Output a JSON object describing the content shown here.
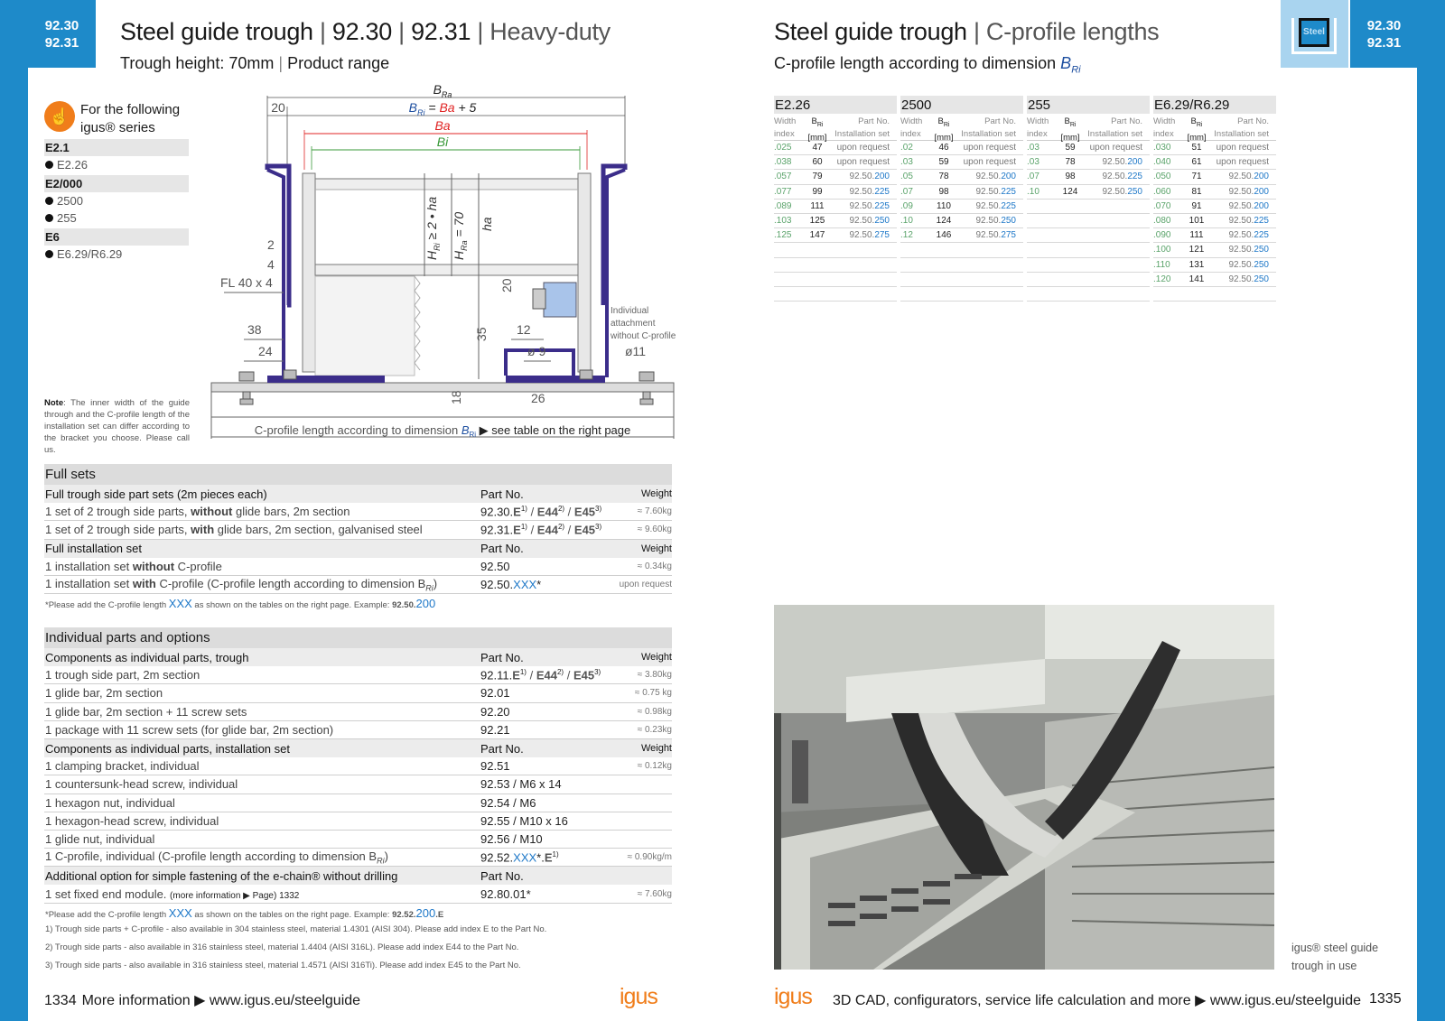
{
  "left_page": {
    "page_numbers": [
      "92.30",
      "92.31"
    ],
    "title_main": "Steel guide trough",
    "title_sep_1": " | ",
    "title_code_1": "92.30",
    "title_sep_2": " | ",
    "title_code_2": "92.31",
    "title_sep_3": " | ",
    "title_light": "Heavy-duty",
    "subtitle_a": "Trough height: 70mm",
    "subtitle_sep": " | ",
    "subtitle_b": "Product range",
    "series_intro": "For the following igus® series",
    "series_groups": [
      {
        "name": "E2.1",
        "items": [
          "E2.26"
        ]
      },
      {
        "name": "E2/000",
        "items": [
          "2500",
          "255"
        ]
      },
      {
        "name": "E6",
        "items": [
          "E6.29/R6.29"
        ]
      }
    ],
    "note_label": "Note",
    "note_text": ": The inner width of the guide through and the C-profile length of the installation set can differ according to the bracket you choose. Please call us.",
    "drawing": {
      "bra": "B",
      "bra_sub": "Ra",
      "formula_b": "B",
      "formula_sub": "Ri",
      "formula_eq": " = ",
      "formula_ba": "Ba",
      "formula_plus": " + 5",
      "ba": "Ba",
      "bi": "Bi",
      "dim_20": "20",
      "dim_2": "2",
      "dim_4": "4",
      "fl": "FL 40 x 4",
      "dim_38": "38",
      "dim_24": "24",
      "hri": "H",
      "hri_sub": "Ri",
      "hri_rest": " ≥ 2 • ha",
      "hra": "H",
      "hra_sub": "Ra",
      "hra_rest": " = 70",
      "ha": "ha",
      "dim_20v": "20",
      "dim_35": "35",
      "dim_12": "12",
      "dim_d9": "ø 9",
      "dim_18": "18",
      "dim_26": "26",
      "dim_d11": "ø11",
      "attachment": [
        "Individual",
        "attachment",
        "without C-profile"
      ],
      "bottom_label_a": "C-profile length according to dimension ",
      "bottom_label_b": "B",
      "bottom_label_sub": "Ri",
      "bottom_label_c": " ▶ see table on the right page"
    },
    "full_sets": {
      "title": "Full sets",
      "rows": [
        {
          "type": "hd",
          "c1": "Full trough side part sets (2m pieces each)",
          "c2": "Part No.",
          "c3": "Weight"
        },
        {
          "type": "row",
          "c1a": "1 set of 2 trough side parts, ",
          "c1b": "without",
          "c1c": " glide bars, 2m section",
          "c2a": "92.30.",
          "c2b": "E",
          "c2c": "1)",
          "c2d": " / ",
          "c2e": "E44",
          "c2f": "2)",
          "c2g": " / ",
          "c2h": "E45",
          "c2i": "3)",
          "c3": "≈ 7.60kg"
        },
        {
          "type": "row",
          "c1a": "1 set of 2 trough side parts, ",
          "c1b": "with",
          "c1c": " glide bars, 2m section, galvanised steel",
          "c2a": "92.31.",
          "c2b": "E",
          "c2c": "1)",
          "c2d": " / ",
          "c2e": "E44",
          "c2f": "2)",
          "c2g": " / ",
          "c2h": "E45",
          "c2i": "3)",
          "c3": "≈ 9.60kg"
        },
        {
          "type": "hd",
          "c1": "Full installation set",
          "c2": "Part No.",
          "c3": "Weight"
        },
        {
          "type": "row",
          "c1a": "1 installation set ",
          "c1b": "without",
          "c1c": " C-profile",
          "c2a": "92.50",
          "c3": "≈ 0.34kg"
        },
        {
          "type": "row",
          "c1a": "1 installation set ",
          "c1b": "with",
          "c1c": " C-profile (C-profile length according to dimension B",
          "c1d": "Ri",
          "c1e": ")",
          "c2a": "92.50.",
          "c2x": "XXX",
          "c2z": "*",
          "c3": "upon request"
        }
      ],
      "footnote_a": "*Please add the C-profile length ",
      "footnote_xxx": "XXX",
      "footnote_b": " as shown on the tables on the right page. Example: ",
      "footnote_ex": "92.50.",
      "footnote_ex2": "200"
    },
    "individual": {
      "title": "Individual parts and options",
      "rows": [
        {
          "type": "hd",
          "c1": "Components as individual parts, trough",
          "c2": "Part No.",
          "c3": "Weight"
        },
        {
          "type": "row",
          "c1a": "1 trough side part, 2m section",
          "c2a": "92.11.",
          "c2b": "E",
          "c2c": "1)",
          "c2d": " / ",
          "c2e": "E44",
          "c2f": "2)",
          "c2g": " / ",
          "c2h": "E45",
          "c2i": "3)",
          "c3": "≈ 3.80kg"
        },
        {
          "type": "row",
          "c1a": "1 glide bar, 2m section",
          "c2a": "92.01",
          "c3": "≈ 0.75 kg"
        },
        {
          "type": "row",
          "c1a": "1 glide bar, 2m section + 11 screw sets",
          "c2a": "92.20",
          "c3": "≈ 0.98kg"
        },
        {
          "type": "row",
          "c1a": "1 package with 11 screw sets (for glide bar, 2m section)",
          "c2a": "92.21",
          "c3": "≈ 0.23kg"
        },
        {
          "type": "hd",
          "c1": "Components as individual parts, installation set",
          "c2": "Part No.",
          "c3": "Weight"
        },
        {
          "type": "row",
          "c1a": "1 clamping bracket, individual",
          "c2a": "92.51",
          "c3": "≈ 0.12kg"
        },
        {
          "type": "row",
          "c1a": "1 countersunk-head screw, individual",
          "c2a": "92.53 / M6 x 14",
          "c3": ""
        },
        {
          "type": "row",
          "c1a": "1 hexagon nut, individual",
          "c2a": "92.54 / M6",
          "c3": ""
        },
        {
          "type": "row",
          "c1a": "1 hexagon-head screw, individual",
          "c2a": "92.55 / M10 x 16",
          "c3": ""
        },
        {
          "type": "row",
          "c1a": "1 glide nut, individual",
          "c2a": "92.56 / M10",
          "c3": ""
        },
        {
          "type": "row",
          "c1a": "1 C-profile, individual (C-profile length according to dimension B",
          "c1d": "Ri",
          "c1e": ")",
          "c2a": "92.52.",
          "c2x": "XXX",
          "c2z": "*.",
          "c2b": "E",
          "c2c": "1)",
          "c3": "≈ 0.90kg/m"
        },
        {
          "type": "hd",
          "c1": "Additional option for simple fastening of the e-chain® without drilling",
          "c2": "Part No.",
          "c3": ""
        },
        {
          "type": "row",
          "c1a": "1 set fixed end module. ",
          "c1s": "(more information ▶ Page) 1332",
          "c2a": "92.80.01*",
          "c3": "≈ 7.60kg"
        }
      ],
      "footnote_a": "*Please add the C-profile length ",
      "footnote_xxx": "XXX",
      "footnote_b": " as shown on the tables on the right page. Example: ",
      "footnote_ex": "92.52.",
      "footnote_ex2": "200",
      "footnote_ex3": ".E",
      "notes": [
        "1) Trough side parts + C-profile - also available in 304 stainless steel, material 1.4301 (AISI 304). Please add index E to the Part No.",
        "2) Trough side parts - also available in 316 stainless steel, material 1.4404 (AISI 316L). Please add index E44 to the Part No.",
        "3) Trough side parts - also available in 316 stainless steel, material 1.4571 (AISI 316Ti). Please add index E45 to the Part No."
      ]
    },
    "footer_page": "1334",
    "footer_text": "More information ▶ www.igus.eu/steelguide",
    "logo": "igus"
  },
  "right_page": {
    "page_numbers": [
      "92.30",
      "92.31"
    ],
    "steel_badge": "Steel",
    "title_main": "Steel guide trough",
    "title_sep": " | ",
    "title_light": "C-profile lengths",
    "subtitle": "C-profile length according to dimension ",
    "subtitle_b": "B",
    "subtitle_sub": "Ri",
    "col_heads": {
      "a1": "Width",
      "a2": "index",
      "b1": "B",
      "b1sub": "Ri",
      "b2": "[mm]",
      "c1": "Part No.",
      "c2": "Installation set"
    },
    "tables": [
      {
        "title": "E2.26",
        "rows": [
          [
            ".025",
            "47",
            "upon request",
            ""
          ],
          [
            ".038",
            "60",
            "upon request",
            ""
          ],
          [
            ".057",
            "79",
            "92.50.",
            "200"
          ],
          [
            ".077",
            "99",
            "92.50.",
            "225"
          ],
          [
            ".089",
            "111",
            "92.50.",
            "225"
          ],
          [
            ".103",
            "125",
            "92.50.",
            "250"
          ],
          [
            ".125",
            "147",
            "92.50.",
            "275"
          ],
          [
            "",
            "",
            "",
            ""
          ],
          [
            "",
            "",
            "",
            ""
          ],
          [
            "",
            "",
            "",
            ""
          ],
          [
            "",
            "",
            "",
            ""
          ]
        ]
      },
      {
        "title": "2500",
        "rows": [
          [
            ".02",
            "46",
            "upon request",
            ""
          ],
          [
            ".03",
            "59",
            "upon request",
            ""
          ],
          [
            ".05",
            "78",
            "92.50.",
            "200"
          ],
          [
            ".07",
            "98",
            "92.50.",
            "225"
          ],
          [
            ".09",
            "110",
            "92.50.",
            "225"
          ],
          [
            ".10",
            "124",
            "92.50.",
            "250"
          ],
          [
            ".12",
            "146",
            "92.50.",
            "275"
          ],
          [
            "",
            "",
            "",
            ""
          ],
          [
            "",
            "",
            "",
            ""
          ],
          [
            "",
            "",
            "",
            ""
          ],
          [
            "",
            "",
            "",
            ""
          ]
        ]
      },
      {
        "title": "255",
        "rows": [
          [
            ".03",
            "59",
            "upon request",
            ""
          ],
          [
            ".03",
            "78",
            "92.50.",
            "200"
          ],
          [
            ".07",
            "98",
            "92.50.",
            "225"
          ],
          [
            ".10",
            "124",
            "92.50.",
            "250"
          ],
          [
            "",
            "",
            "",
            ""
          ],
          [
            "",
            "",
            "",
            ""
          ],
          [
            "",
            "",
            "",
            ""
          ],
          [
            "",
            "",
            "",
            ""
          ],
          [
            "",
            "",
            "",
            ""
          ],
          [
            "",
            "",
            "",
            ""
          ],
          [
            "",
            "",
            "",
            ""
          ]
        ]
      },
      {
        "title": "E6.29/R6.29",
        "rows": [
          [
            ".030",
            "51",
            "upon request",
            ""
          ],
          [
            ".040",
            "61",
            "upon request",
            ""
          ],
          [
            ".050",
            "71",
            "92.50.",
            "200"
          ],
          [
            ".060",
            "81",
            "92.50.",
            "200"
          ],
          [
            ".070",
            "91",
            "92.50.",
            "200"
          ],
          [
            ".080",
            "101",
            "92.50.",
            "225"
          ],
          [
            ".090",
            "111",
            "92.50.",
            "225"
          ],
          [
            ".100",
            "121",
            "92.50.",
            "250"
          ],
          [
            ".110",
            "131",
            "92.50.",
            "250"
          ],
          [
            ".120",
            "141",
            "92.50.",
            "250"
          ],
          [
            "",
            "",
            "",
            ""
          ]
        ]
      }
    ],
    "caption": [
      "igus® steel guide",
      "trough in use"
    ],
    "footer_logo": "igus",
    "footer_text": "3D CAD, configurators, service life calculation and more ▶ www.igus.eu/steelguide",
    "footer_page": "1335"
  },
  "colors": {
    "accent_blue": "#1e8ac9",
    "light_blue": "#a9d4ef",
    "igus_orange": "#f07d1a",
    "dim_red": "#e02424",
    "dim_green": "#3a9a3a",
    "trough_purple": "#3b2d8a"
  }
}
